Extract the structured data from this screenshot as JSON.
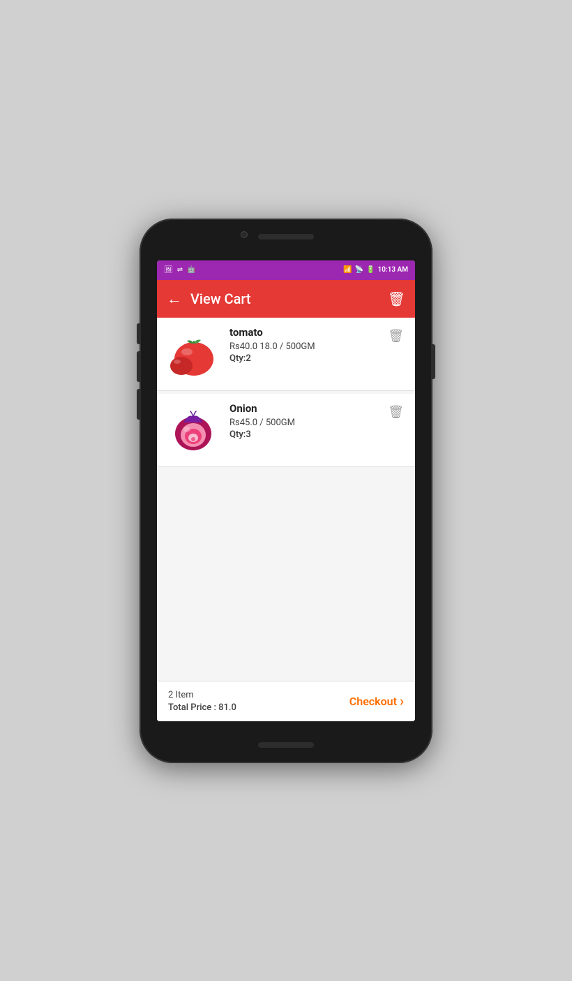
{
  "statusBar": {
    "time": "10:13 AM",
    "icons": [
      "wifi",
      "signal",
      "battery"
    ]
  },
  "toolbar": {
    "title": "View Cart",
    "backLabel": "←",
    "deleteLabel": "🗑"
  },
  "cartItems": [
    {
      "id": 1,
      "name": "tomato",
      "price": "Rs40.0  18.0 / 500GM",
      "qty": "Qty:2",
      "type": "tomato"
    },
    {
      "id": 2,
      "name": "Onion",
      "price": "Rs45.0 / 500GM",
      "qty": "Qty:3",
      "type": "onion"
    }
  ],
  "footer": {
    "itemCount": "2 Item",
    "totalLabel": "Total Price : 81.0",
    "checkoutLabel": "Checkout",
    "checkoutArrow": "›"
  }
}
